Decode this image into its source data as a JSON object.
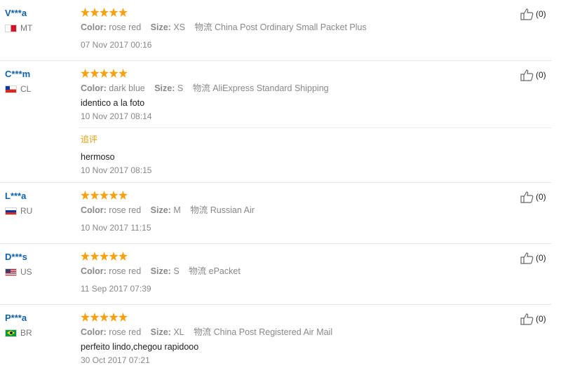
{
  "labels": {
    "color": "Color:",
    "size": "Size:",
    "shipping": "物流",
    "followup": "追评"
  },
  "reviews": [
    {
      "user": "V***a",
      "country": "MT",
      "flag": "malta",
      "color": "rose red",
      "size": "XS",
      "shipping": "China Post Ordinary Small Packet Plus",
      "comment": "",
      "date": "07 Nov 2017 00:16",
      "helpful": "(0)"
    },
    {
      "user": "C***m",
      "country": "CL",
      "flag": "chile",
      "color": "dark blue",
      "size": "S",
      "shipping": "AliExpress Standard Shipping",
      "comment": "identico a la foto",
      "date": "10 Nov 2017 08:14",
      "helpful": "(0)",
      "followup": {
        "comment": "hermoso",
        "date": "10 Nov 2017 08:15"
      }
    },
    {
      "user": "L***a",
      "country": "RU",
      "flag": "russia",
      "color": "rose red",
      "size": "M",
      "shipping": "Russian Air",
      "comment": "",
      "date": "10 Nov 2017 11:15",
      "helpful": "(0)"
    },
    {
      "user": "D***s",
      "country": "US",
      "flag": "usa",
      "color": "rose red",
      "size": "S",
      "shipping": "ePacket",
      "comment": "",
      "date": "11 Sep 2017 07:39",
      "helpful": "(0)"
    },
    {
      "user": "P***a",
      "country": "BR",
      "flag": "brazil",
      "color": "rose red",
      "size": "XL",
      "shipping": "China Post Registered Air Mail",
      "comment": "perfeito lindo,chegou rapidooo",
      "date": "30 Oct 2017 07:21",
      "helpful": "(0)"
    }
  ]
}
